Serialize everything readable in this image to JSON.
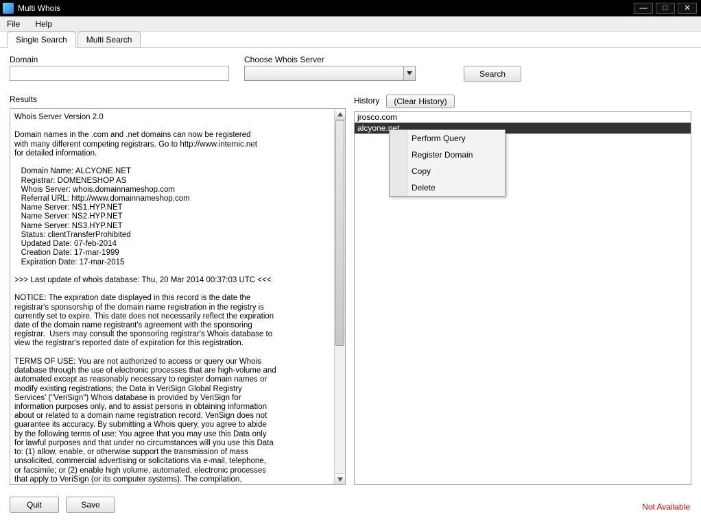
{
  "window": {
    "title": "Multi Whois"
  },
  "menubar": {
    "file": "File",
    "help": "Help"
  },
  "tabs": {
    "single": "Single Search",
    "multi": "Multi Search"
  },
  "form": {
    "domain_label": "Domain",
    "server_label": "Choose Whois Server",
    "search_btn": "Search",
    "domain_value": "",
    "server_value": ""
  },
  "results": {
    "label": "Results",
    "text": "Whois Server Version 2.0\n\nDomain names in the .com and .net domains can now be registered\nwith many different competing registrars. Go to http://www.internic.net\nfor detailed information.\n\n   Domain Name: ALCYONE.NET\n   Registrar: DOMENESHOP AS\n   Whois Server: whois.domainnameshop.com\n   Referral URL: http://www.domainnameshop.com\n   Name Server: NS1.HYP.NET\n   Name Server: NS2.HYP.NET\n   Name Server: NS3.HYP.NET\n   Status: clientTransferProhibited\n   Updated Date: 07-feb-2014\n   Creation Date: 17-mar-1999\n   Expiration Date: 17-mar-2015\n\n>>> Last update of whois database: Thu, 20 Mar 2014 00:37:03 UTC <<<\n\nNOTICE: The expiration date displayed in this record is the date the\nregistrar's sponsorship of the domain name registration in the registry is\ncurrently set to expire. This date does not necessarily reflect the expiration\ndate of the domain name registrant's agreement with the sponsoring\nregistrar.  Users may consult the sponsoring registrar's Whois database to\nview the registrar's reported date of expiration for this registration.\n\nTERMS OF USE: You are not authorized to access or query our Whois\ndatabase through the use of electronic processes that are high-volume and\nautomated except as reasonably necessary to register domain names or\nmodify existing registrations; the Data in VeriSign Global Registry\nServices' (\"VeriSign\") Whois database is provided by VeriSign for\ninformation purposes only, and to assist persons in obtaining information\nabout or related to a domain name registration record. VeriSign does not\nguarantee its accuracy. By submitting a Whois query, you agree to abide\nby the following terms of use: You agree that you may use this Data only\nfor lawful purposes and that under no circumstances will you use this Data\nto: (1) allow, enable, or otherwise support the transmission of mass\nunsolicited, commercial advertising or solicitations via e-mail, telephone,\nor facsimile; or (2) enable high volume, automated, electronic processes\nthat apply to VeriSign (or its computer systems). The compilation,"
  },
  "history": {
    "label": "History",
    "clear_btn": "(Clear History)",
    "items": [
      "jrosco.com",
      "alcyone.net"
    ],
    "selected_index": 1
  },
  "context_menu": {
    "perform": "Perform Query",
    "register": "Register Domain",
    "copy": "Copy",
    "delete": "Delete"
  },
  "footer": {
    "quit": "Quit",
    "save": "Save"
  },
  "status": {
    "right": "Not Available"
  }
}
